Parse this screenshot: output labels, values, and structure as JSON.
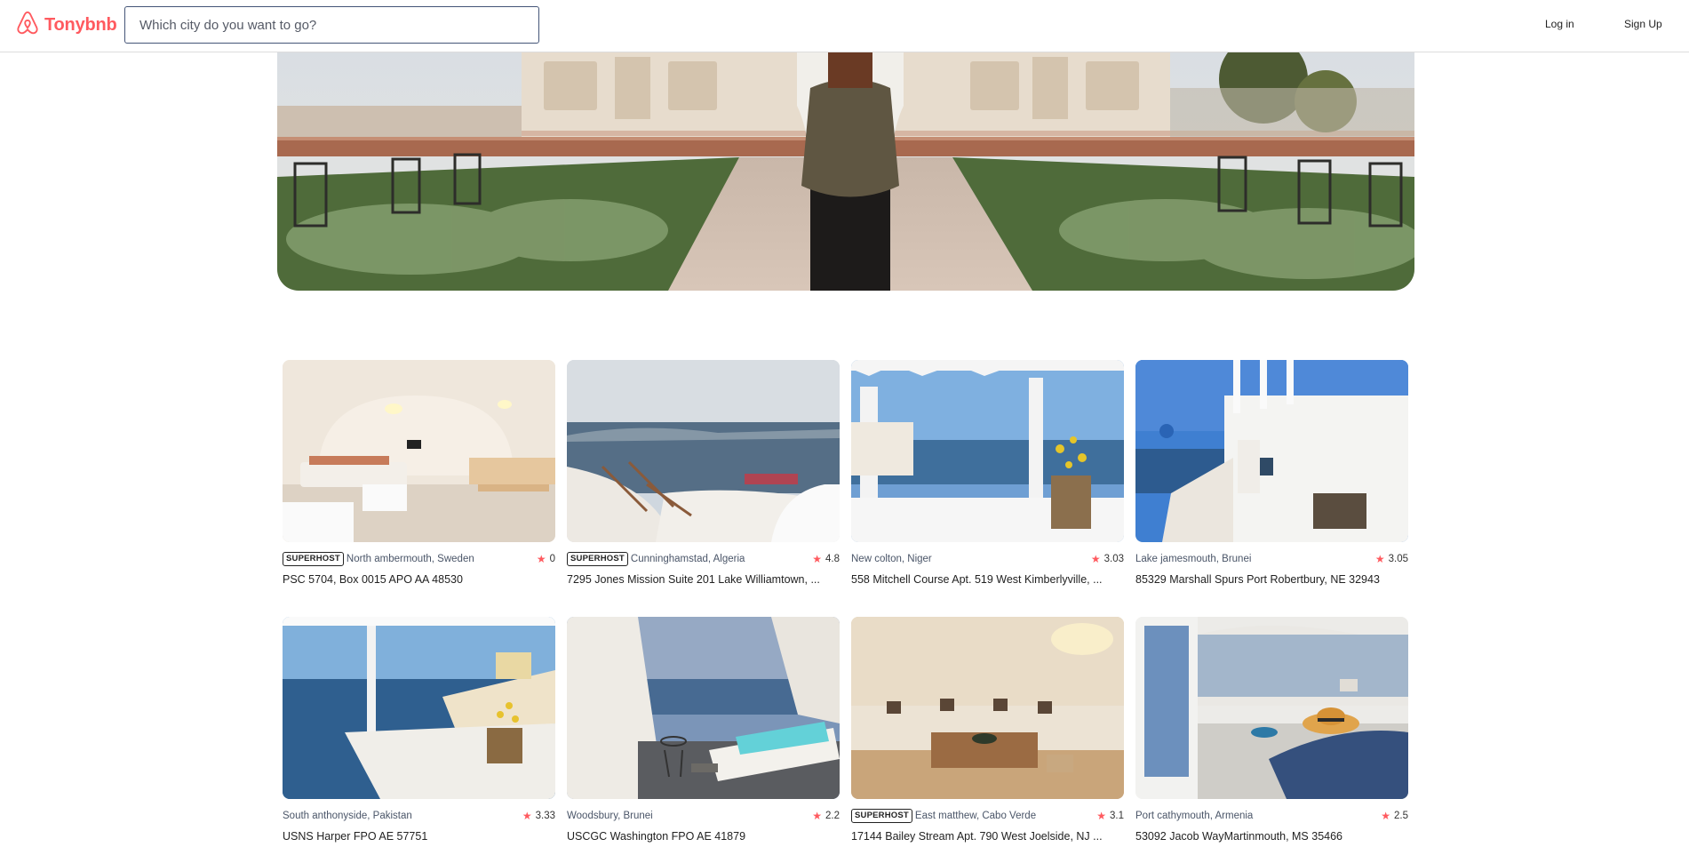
{
  "app": {
    "name": "Tonybnb",
    "brand_color": "#ff5a5f"
  },
  "header": {
    "search_placeholder": "Which city do you want to go?",
    "login_label": "Log in",
    "signup_label": "Sign Up"
  },
  "hero": {
    "image": "traveler-with-backpack-at-garden-palace"
  },
  "listings": [
    {
      "superhost": true,
      "badge": "SUPERHOST",
      "location": "North ambermouth, Sweden",
      "rating": "0",
      "address": "PSC 5704, Box 0015 APO AA 48530",
      "image": "cave-living-room"
    },
    {
      "superhost": true,
      "badge": "SUPERHOST",
      "location": "Cunninghamstad, Algeria",
      "rating": "4.8",
      "address": "7295 Jones Mission Suite 201 Lake Williamtown, ...",
      "image": "terrace-sea-view-loungers"
    },
    {
      "superhost": false,
      "badge": "",
      "location": "New colton, Niger",
      "rating": "3.03",
      "address": "558 Mitchell Course Apt. 519 West Kimberlyville, ...",
      "image": "pergola-balcony-sea-view"
    },
    {
      "superhost": false,
      "badge": "",
      "location": "Lake jamesmouth, Brunei",
      "rating": "3.05",
      "address": "85329 Marshall Spurs Port Robertbury, NE 32943",
      "image": "white-village-stairs"
    },
    {
      "superhost": false,
      "badge": "",
      "location": "South anthonyside, Pakistan",
      "rating": "3.33",
      "address": "USNS Harper FPO AE 57751",
      "image": "balcony-flowers-sea"
    },
    {
      "superhost": false,
      "badge": "",
      "location": "Woodsbury, Brunei",
      "rating": "2.2",
      "address": "USCGC Washington FPO AE 41879",
      "image": "plunge-pool-terrace"
    },
    {
      "superhost": true,
      "badge": "SUPERHOST",
      "location": "East matthew, Cabo Verde",
      "rating": "3.1",
      "address": "17144 Bailey Stream Apt. 790 West Joelside, NJ ...",
      "image": "cave-lounge-sofa"
    },
    {
      "superhost": false,
      "badge": "",
      "location": "Port cathymouth, Armenia",
      "rating": "2.5",
      "address": "53092 Jacob WayMartinmouth, MS 35466",
      "image": "window-table-hat"
    }
  ]
}
